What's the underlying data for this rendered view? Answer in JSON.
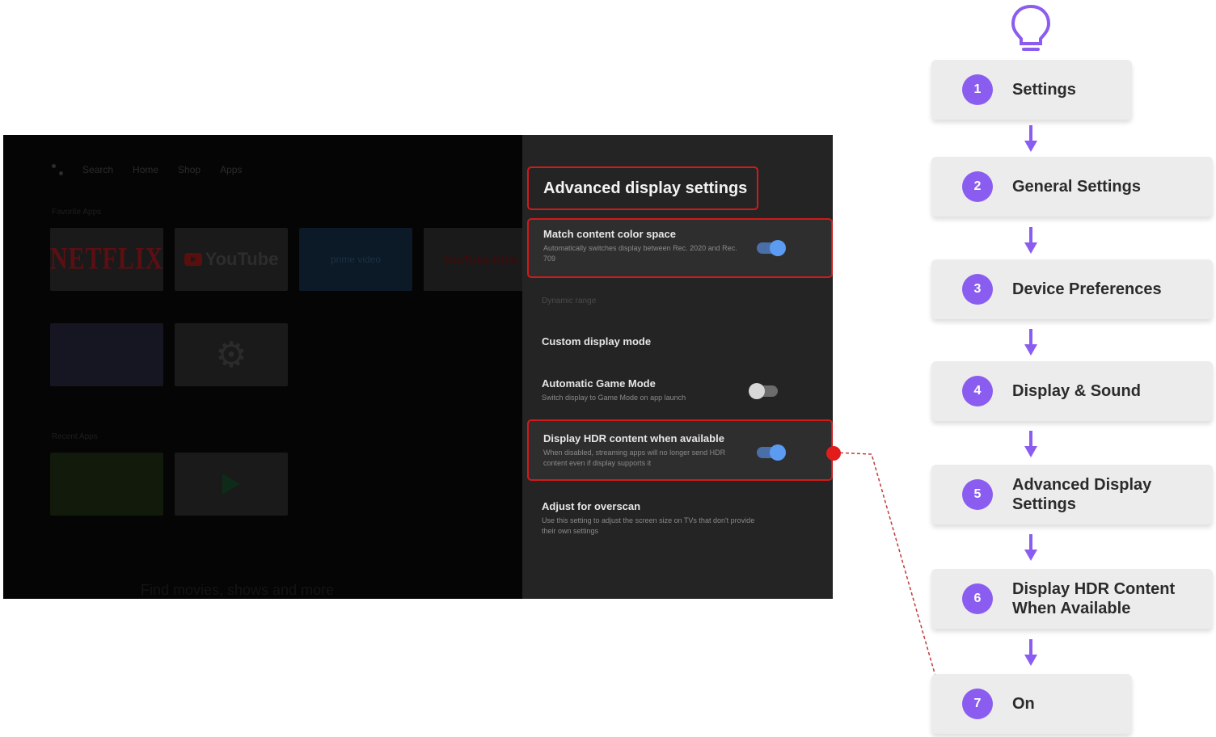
{
  "tv": {
    "nav": [
      "Search",
      "Home",
      "Shop",
      "Apps"
    ],
    "row1_label": "Favorite Apps",
    "row2_label": "Recent Apps",
    "tiles": {
      "netflix": "NETFLIX",
      "youtube": "YouTube",
      "prime": "prime video",
      "ytkids": "YouTube Kids",
      "settings_icon": "gear-icon"
    },
    "home_bottom_text": "Find movies, shows and more"
  },
  "panel": {
    "title": "Advanced display settings",
    "section_label": "Dynamic range",
    "settings": [
      {
        "title": "Match content color space",
        "desc": "Automatically switches display between Rec. 2020 and Rec. 709",
        "toggle": "on"
      },
      {
        "title": "Custom display mode",
        "desc": ""
      },
      {
        "title": "Automatic Game Mode",
        "desc": "Switch display to Game Mode on app launch",
        "toggle": "off"
      },
      {
        "title": "Display HDR content when available",
        "desc": "When disabled, streaming apps will no longer send HDR content even if display supports it",
        "toggle": "on"
      },
      {
        "title": "Adjust for overscan",
        "desc": "Use this setting to adjust the screen size on TVs that don't provide their own settings"
      }
    ]
  },
  "steps": [
    {
      "num": "1",
      "label": "Settings"
    },
    {
      "num": "2",
      "label": "General Settings"
    },
    {
      "num": "3",
      "label": "Device Preferences"
    },
    {
      "num": "4",
      "label": "Display & Sound"
    },
    {
      "num": "5",
      "label": "Advanced Display Settings"
    },
    {
      "num": "6",
      "label": "Display HDR Content When Available"
    },
    {
      "num": "7",
      "label": "On"
    }
  ],
  "colors": {
    "accent_purple": "#8a5df0",
    "highlight_red": "#d11a1a",
    "toggle_on": "#5b9cf2"
  },
  "icons": {
    "top": "lightbulb-icon",
    "between_steps": "down-arrow-icon"
  }
}
